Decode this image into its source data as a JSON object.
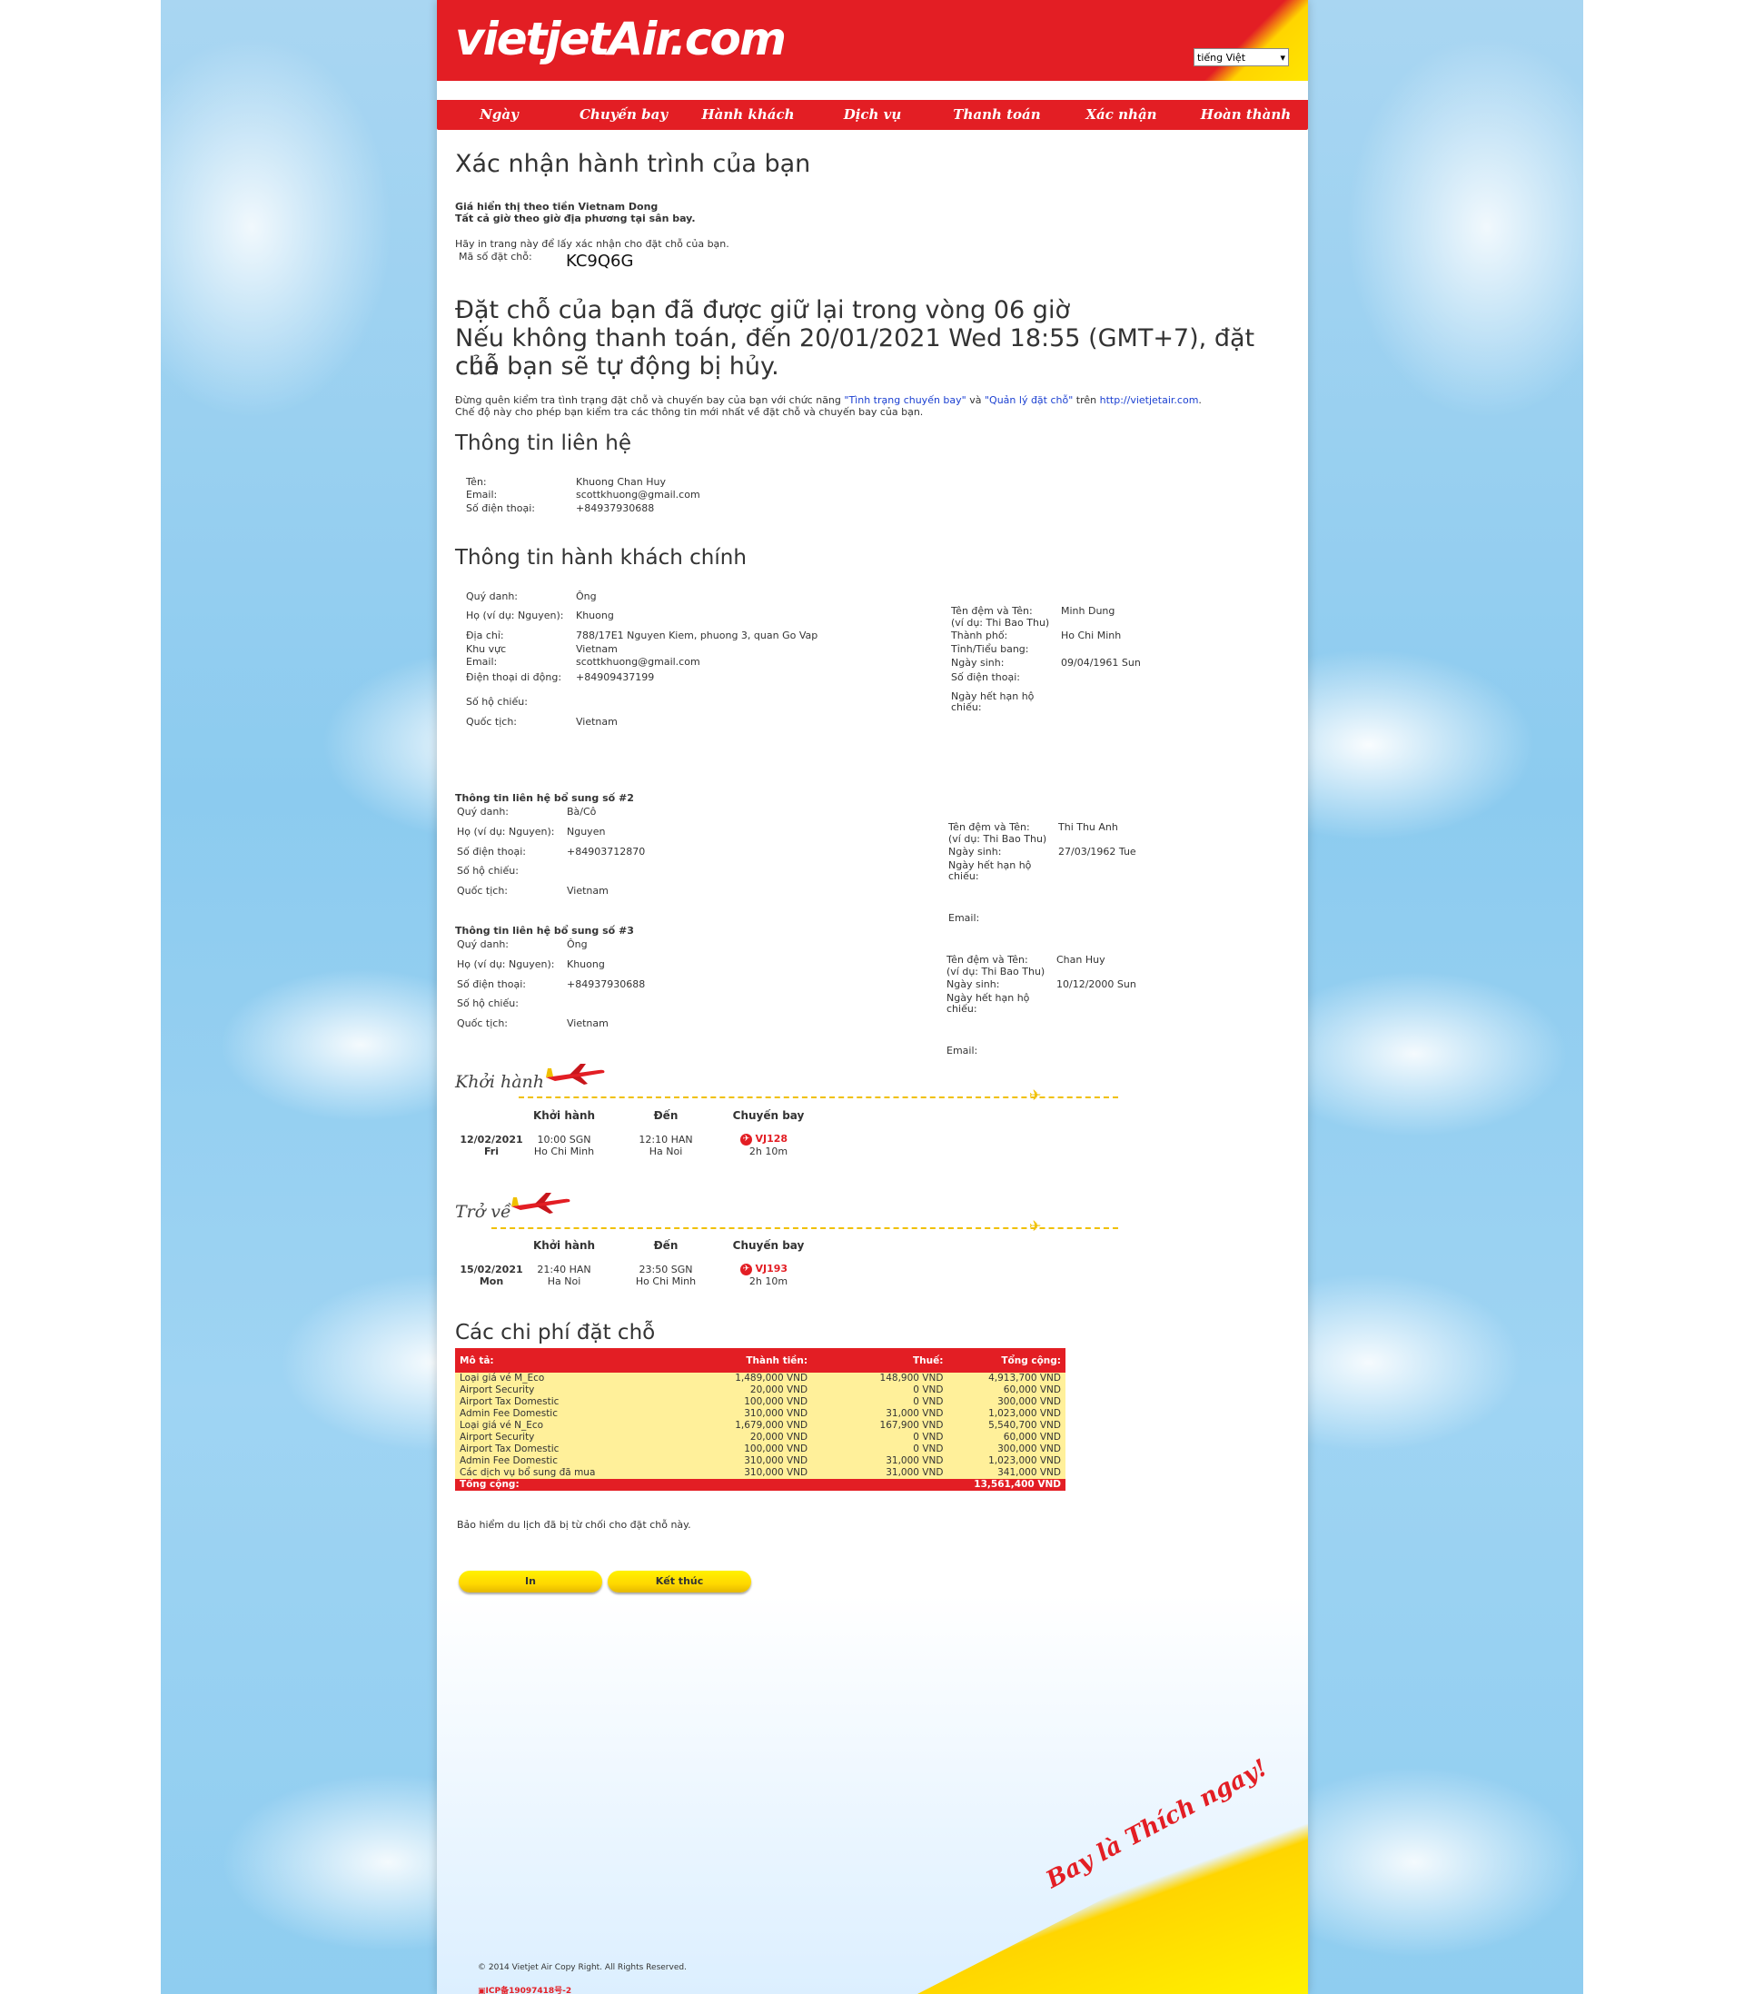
{
  "header": {
    "logo": "vietjetAir.com",
    "language": "tiếng Việt"
  },
  "nav": [
    "Ngày",
    "Chuyến bay",
    "Hành khách",
    "Dịch vụ",
    "Thanh toán",
    "Xác nhận",
    "Hoàn thành"
  ],
  "page": {
    "title": "Xác nhận hành trình của bạn",
    "currency_note": "Giá hiển thị theo tiền Vietnam Dong",
    "time_note": "Tất cả giờ theo giờ địa phương tại sân bay.",
    "print_note": "Hãy in trang này để lấy xác nhận cho đặt chỗ của bạn.",
    "booking_code_label": "Mã số đặt chỗ:",
    "booking_code": "KC9Q6G",
    "hold_line1": "Đặt chỗ của bạn đã được giữ lại trong vòng 06 giờ",
    "hold_line2": "Nếu không thanh toán, đến 20/01/2021 Wed 18:55 (GMT+7), đặt chỗ",
    "hold_line3": "của bạn sẽ tự động bị hủy.",
    "reminder_pre": "Đừng quên kiểm tra tình trạng đặt chỗ và chuyến bay của bạn với chức năng ",
    "reminder_link1": "\"Tình trạng chuyến bay\"",
    "reminder_mid": " và ",
    "reminder_link2": "\"Quản lý đặt chỗ\"",
    "reminder_on": " trên ",
    "reminder_url": "http://vietjetair.com",
    "reminder_line2": "Chế độ này cho phép bạn kiểm tra các thông tin mới nhất về đặt chỗ và chuyến bay của bạn."
  },
  "contact": {
    "heading": "Thông tin liên hệ",
    "name_label": "Tên:",
    "name": "Khuong Chan Huy",
    "email_label": "Email:",
    "email": "scottkhuong@gmail.com",
    "phone_label": "Số điện thoại:",
    "phone": "+84937930688"
  },
  "main_passenger": {
    "heading": "Thông tin hành khách chính",
    "title_label": "Quý danh:",
    "title": "Ông",
    "surname_label": "Họ (ví dụ: Nguyen):",
    "surname": "Khuong",
    "address_label": "Địa chỉ:",
    "address": "788/17E1 Nguyen Kiem, phuong 3, quan Go Vap",
    "region_label": "Khu vực",
    "region": "Vietnam",
    "email_label": "Email:",
    "email": "scottkhuong@gmail.com",
    "mobile_label": "Điện thoại di động:",
    "mobile": "+84909437199",
    "passport_label": "Số hộ chiếu:",
    "nationality_label": "Quốc tịch:",
    "nationality": "Vietnam",
    "given_label1": "Tên đệm và Tên:",
    "given_label2": "(ví dụ: Thi Bao Thu)",
    "given": "Minh Dung",
    "city_label": "Thành phố:",
    "city": "Ho Chi Minh",
    "province_label": "Tỉnh/Tiểu bang:",
    "dob_label": "Ngày sinh:",
    "dob": "09/04/1961 Sun",
    "phone_label": "Số điện thoại:",
    "expiry_label1": "Ngày hết hạn hộ",
    "expiry_label2": "chiếu:"
  },
  "extra2": {
    "heading": "Thông tin liên hệ bổ sung số #2",
    "title_label": "Quý danh:",
    "title": "Bà/Cô",
    "surname_label": "Họ (ví dụ: Nguyen):",
    "surname": "Nguyen",
    "phone_label": "Số điện thoại:",
    "phone": "+84903712870",
    "passport_label": "Số hộ chiếu:",
    "nationality_label": "Quốc tịch:",
    "nationality": "Vietnam",
    "given_label1": "Tên đệm và Tên:",
    "given_label2": "(ví dụ: Thi Bao Thu)",
    "given": "Thi Thu Anh",
    "dob_label": "Ngày sinh:",
    "dob": "27/03/1962 Tue",
    "expiry_label1": "Ngày hết hạn hộ",
    "expiry_label2": "chiếu:",
    "email_label": "Email:"
  },
  "extra3": {
    "heading": "Thông tin liên hệ bổ sung số #3",
    "title_label": "Quý danh:",
    "title": "Ông",
    "surname_label": "Họ (ví dụ: Nguyen):",
    "surname": "Khuong",
    "phone_label": "Số điện thoại:",
    "phone": "+84937930688",
    "passport_label": "Số hộ chiếu:",
    "nationality_label": "Quốc tịch:",
    "nationality": "Vietnam",
    "given_label1": "Tên đệm và Tên:",
    "given_label2": "(ví dụ: Thi Bao Thu)",
    "given": "Chan Huy",
    "dob_label": "Ngày sinh:",
    "dob": "10/12/2000 Sun",
    "expiry_label1": "Ngày hết hạn hộ",
    "expiry_label2": "chiếu:",
    "email_label": "Email:"
  },
  "flights": {
    "col_depart": "Khởi hành",
    "col_arrive": "Đến",
    "col_flight": "Chuyến bay",
    "outbound": {
      "title": "Khởi hành",
      "date": "12/02/2021",
      "day": "Fri",
      "dep_time": "10:00 SGN",
      "dep_city": "Ho Chi Minh",
      "arr_time": "12:10 HAN",
      "arr_city": "Ha Noi",
      "flight": "VJ128",
      "duration": "2h 10m"
    },
    "return": {
      "title": "Trở về",
      "date": "15/02/2021",
      "day": "Mon",
      "dep_time": "21:40 HAN",
      "dep_city": "Ha Noi",
      "arr_time": "23:50 SGN",
      "arr_city": "Ho Chi Minh",
      "flight": "VJ193",
      "duration": "2h 10m"
    }
  },
  "costs": {
    "heading": "Các chi phí đặt chỗ",
    "headers": [
      "Mô tả:",
      "Thành tiền:",
      "Thuế:",
      "Tổng cộng:"
    ],
    "rows": [
      [
        "Loại giá vé M_Eco",
        "1,489,000 VND",
        "148,900 VND",
        "4,913,700 VND"
      ],
      [
        "Airport Security",
        "20,000 VND",
        "0 VND",
        "60,000 VND"
      ],
      [
        "Airport Tax Domestic",
        "100,000 VND",
        "0 VND",
        "300,000 VND"
      ],
      [
        "Admin Fee Domestic",
        "310,000 VND",
        "31,000 VND",
        "1,023,000 VND"
      ],
      [
        "Loại giá vé N_Eco",
        "1,679,000 VND",
        "167,900 VND",
        "5,540,700 VND"
      ],
      [
        "Airport Security",
        "20,000 VND",
        "0 VND",
        "60,000 VND"
      ],
      [
        "Airport Tax Domestic",
        "100,000 VND",
        "0 VND",
        "300,000 VND"
      ],
      [
        "Admin Fee Domestic",
        "310,000 VND",
        "31,000 VND",
        "1,023,000 VND"
      ],
      [
        "Các dịch vụ bổ sung đã mua",
        "310,000 VND",
        "31,000 VND",
        "341,000 VND"
      ]
    ],
    "total_label": "Tổng cộng:",
    "total": "13,561,400 VND"
  },
  "insurance_note": "Bảo hiểm du lịch đã bị từ chối cho đặt chỗ này.",
  "buttons": {
    "print": "In",
    "finish": "Kết thúc"
  },
  "footer": {
    "slogan": "Bay là Thích ngay!",
    "copyright": "© 2014 Vietjet Air Copy Right. All Rights Reserved.",
    "icp": "ICP备19097418号-2"
  },
  "colors": {
    "brand_red": "#e31e24",
    "brand_yellow": "#ffd500"
  },
  "icons": {
    "plane": "plane-icon",
    "flight_marker": "vietjet-flight-icon"
  }
}
